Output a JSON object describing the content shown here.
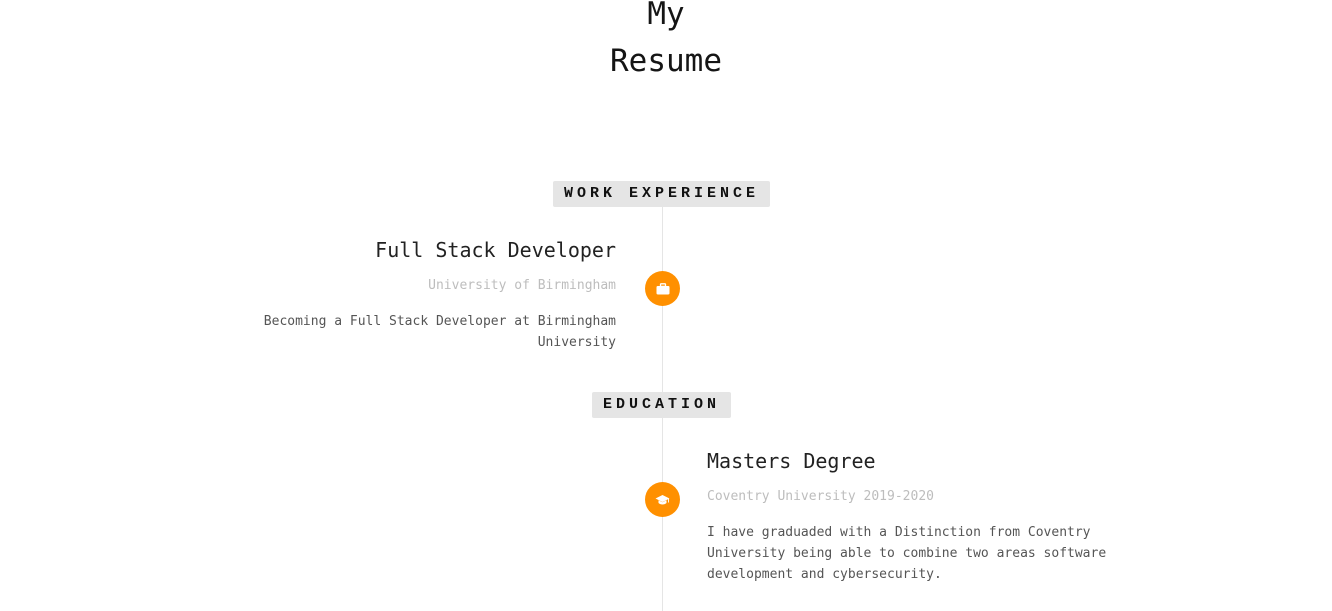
{
  "header": {
    "title_line_1": "My",
    "title_line_2": "Resume"
  },
  "sections": {
    "work": {
      "label": "WORK EXPERIENCE",
      "icon": "briefcase-icon",
      "entry": {
        "role": "Full Stack Developer",
        "organization": "University of Birmingham",
        "description": "Becoming a Full Stack Developer at Birmingham University"
      }
    },
    "education": {
      "label": "EDUCATION",
      "icon": "graduation-cap-icon",
      "entry": {
        "role": "Masters Degree",
        "organization": "Coventry University 2019-2020",
        "description": "I have graduaded with a Distinction from Coventry University being able to combine two areas software development and cybersecurity."
      }
    }
  },
  "colors": {
    "accent": "#ff9000",
    "tag_background": "#e5e5e5",
    "timeline": "#e5e5e5",
    "muted_text": "#bdbdbd"
  }
}
